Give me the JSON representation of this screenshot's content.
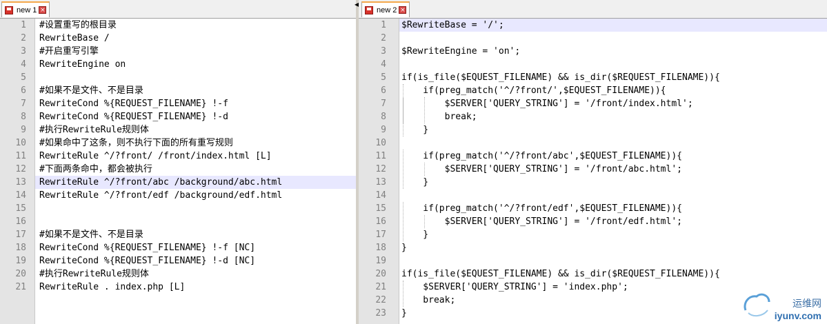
{
  "left_tab": {
    "label": "new 1",
    "close_glyph": "×"
  },
  "right_tab": {
    "label": "new 2",
    "close_glyph": "×"
  },
  "splitter_arrow": "◀",
  "left_lines": [
    "#设置重写的根目录",
    "RewriteBase /",
    "#开启重写引擎",
    "RewriteEngine on",
    "",
    "#如果不是文件、不是目录",
    "RewriteCond %{REQUEST_FILENAME} !-f",
    "RewriteCond %{REQUEST_FILENAME} !-d",
    "#执行RewriteRule规则体",
    "#如果命中了这条，则不执行下面的所有重写规则",
    "RewriteRule ^/?front/ /front/index.html [L]",
    "#下面两条命中，都会被执行",
    "RewriteRule ^/?front/abc /background/abc.html",
    "RewriteRule ^/?front/edf /background/edf.html",
    "",
    "",
    "#如果不是文件、不是目录",
    "RewriteCond %{REQUEST_FILENAME} !-f [NC]",
    "RewriteCond %{REQUEST_FILENAME} !-d [NC]",
    "#执行RewriteRule规则体",
    "RewriteRule . index.php [L]"
  ],
  "left_current_line": 13,
  "right_lines": [
    "$RewriteBase = '/';",
    "",
    "$RewriteEngine = 'on';",
    "",
    "if(is_file($EQUEST_FILENAME) && is_dir($REQUEST_FILENAME)){",
    "    if(preg_match('^/?front/',$EQUEST_FILENAME)){",
    "        $SERVER['QUERY_STRING'] = '/front/index.html';",
    "        break;",
    "    }",
    "",
    "    if(preg_match('^/?front/abc',$EQUEST_FILENAME)){",
    "        $SERVER['QUERY_STRING'] = '/front/abc.html';",
    "    }",
    "",
    "    if(preg_match('^/?front/edf',$EQUEST_FILENAME)){",
    "        $SERVER['QUERY_STRING'] = '/front/edf.html';",
    "    }",
    "}",
    "",
    "if(is_file($EQUEST_FILENAME) && is_dir($REQUEST_FILENAME)){",
    "    $SERVER['QUERY_STRING'] = 'index.php';",
    "    break;",
    "}"
  ],
  "right_current_line": 1,
  "watermark": {
    "cn": "运维网",
    "url": "iyunv.com"
  }
}
